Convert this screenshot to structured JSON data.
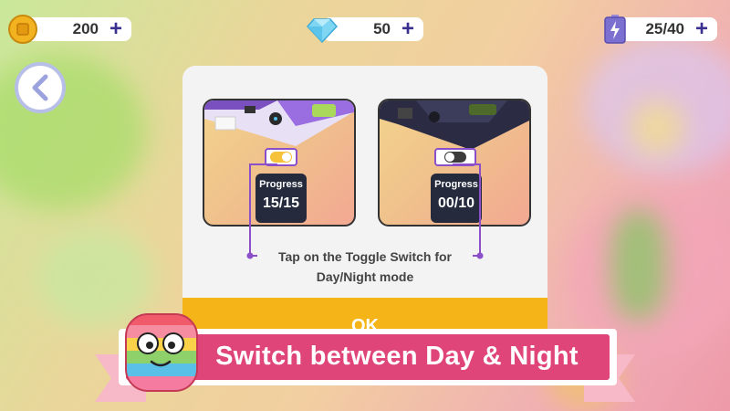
{
  "hud": {
    "coins": {
      "value": "200",
      "plus": "+"
    },
    "gems": {
      "value": "50",
      "plus": "+"
    },
    "energy": {
      "value": "25/40",
      "plus": "+"
    }
  },
  "dialog": {
    "cards": [
      {
        "mode": "day",
        "progress_label": "Progress",
        "progress_value": "15/15"
      },
      {
        "mode": "night",
        "progress_label": "Progress",
        "progress_value": "00/10"
      }
    ],
    "hint_line1": "Tap on the Toggle Switch for",
    "hint_line2": "Day/Night mode",
    "ok_label": "OK"
  },
  "banner": {
    "text": "Switch between Day & Night"
  },
  "colors": {
    "accent_purple": "#8a4fc9",
    "ok_yellow": "#f5b418",
    "banner_pink": "#e0457a",
    "ribbon_pink": "#f7b8c8",
    "hud_plus": "#3b2f8f"
  }
}
